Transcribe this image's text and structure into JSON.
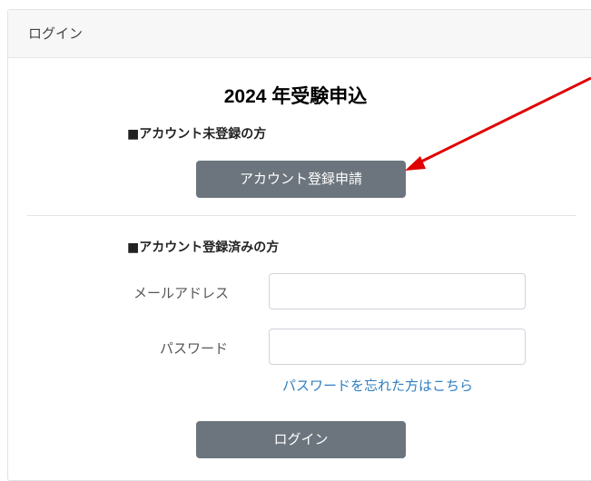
{
  "header": {
    "title": "ログイン"
  },
  "main": {
    "heading": "2024 年受験申込",
    "new_account": {
      "section_label": "■アカウント未登録の方",
      "register_button": "アカウント登録申請"
    },
    "existing_account": {
      "section_label": "■アカウント登録済みの方",
      "email_label": "メールアドレス",
      "email_value": "",
      "password_label": "パスワード",
      "password_value": "",
      "forgot_link": "パスワードを忘れた方はこちら",
      "login_button": "ログイン"
    }
  },
  "annotation": {
    "arrow_color": "#e00000"
  }
}
